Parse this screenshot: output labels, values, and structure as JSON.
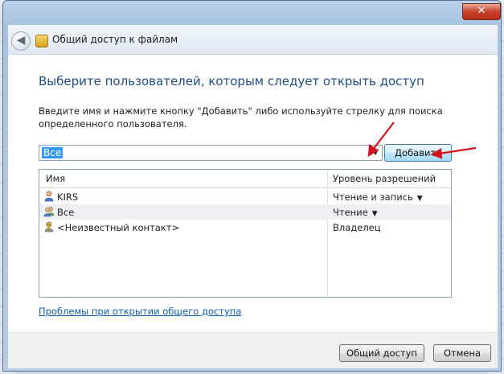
{
  "window": {
    "title": "Общий доступ к файлам",
    "close_glyph": "✕",
    "back_glyph": "◀"
  },
  "main": {
    "heading": "Выберите пользователей, которым следует открыть доступ",
    "instruction": "Введите имя и нажмите кнопку \"Добавить\" либо используйте стрелку для поиска определенного пользователя.",
    "combo_value": "Все",
    "add_button": "Добавить",
    "table": {
      "headers": [
        "Имя",
        "Уровень разрешений"
      ],
      "rows": [
        {
          "name": "KIRS",
          "permission": "Чтение и запись",
          "icon": "user-icon",
          "has_dropdown": true
        },
        {
          "name": "Все",
          "permission": "Чтение",
          "icon": "users-group-icon",
          "has_dropdown": true,
          "selected": true
        },
        {
          "name": "<Неизвестный контакт>",
          "permission": "Владелец",
          "icon": "unknown-contact-icon",
          "has_dropdown": false
        }
      ]
    },
    "help_link": "Проблемы при открытии общего доступа"
  },
  "footer": {
    "share_button": "Общий доступ",
    "cancel_button": "Отмена"
  },
  "colors": {
    "heading": "#1e4c8a",
    "link": "#0e5fb5",
    "annotation_arrows": "#d2141e",
    "selection": "#3399ff"
  }
}
